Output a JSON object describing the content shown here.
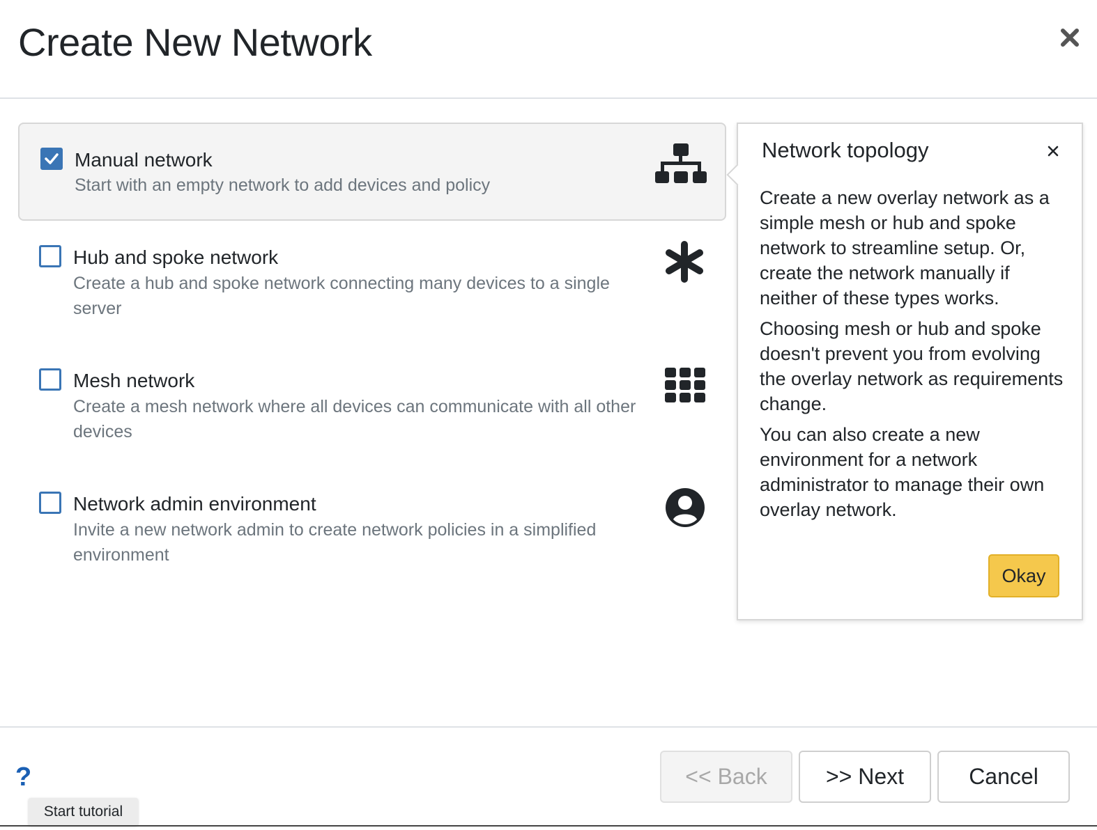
{
  "dialog": {
    "title": "Create New Network"
  },
  "options": [
    {
      "title": "Manual network",
      "description": "Start with an empty network to add devices and policy",
      "checked": true,
      "icon": "sitemap-icon"
    },
    {
      "title": "Hub and spoke network",
      "description": "Create a hub and spoke network connecting many devices to a single server",
      "checked": false,
      "icon": "asterisk-icon"
    },
    {
      "title": "Mesh network",
      "description": "Create a mesh network where all devices can communicate with all other devices",
      "checked": false,
      "icon": "grid-icon"
    },
    {
      "title": "Network admin environment",
      "description": "Invite a new network admin to create network policies in a simplified environment",
      "checked": false,
      "icon": "user-circle-icon"
    }
  ],
  "popover": {
    "title": "Network topology",
    "paragraphs": [
      "Create a new overlay network as a simple mesh or hub and spoke network to streamline setup. Or, create the network manually if neither of these types works.",
      "Choosing mesh or hub and spoke doesn't prevent you from evolving the overlay network as requirements change.",
      "You can also create a new environment for a network administrator to manage their own overlay network."
    ],
    "okay_label": "Okay"
  },
  "footer": {
    "help_glyph": "?",
    "tooltip": "Start tutorial",
    "back_label": "<< Back",
    "back_disabled": true,
    "next_label": ">> Next",
    "cancel_label": "Cancel"
  },
  "colors": {
    "accent": "#3a75b5",
    "okay_button": "#f5c84c",
    "help_icon": "#1a5fb4",
    "selected_option_bg": "#f4f4f4"
  }
}
